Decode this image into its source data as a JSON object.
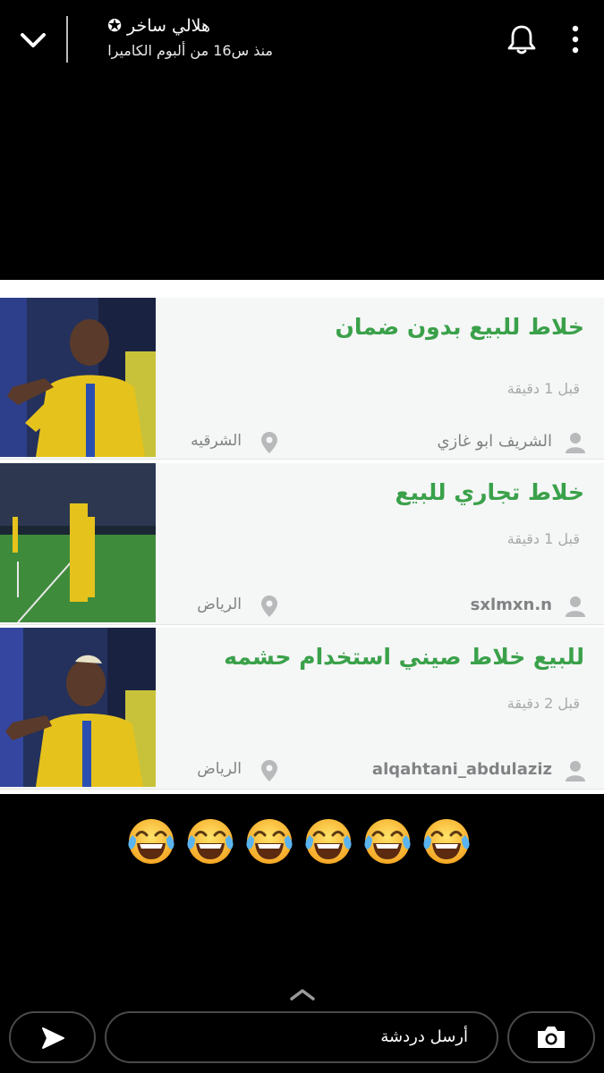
{
  "header": {
    "sender_name": "هلالي ساخر ✪",
    "subtitle": "منذ س16 من ألبوم الكاميرا",
    "back_icon": "chevron-down-icon",
    "notify_icon": "bell-icon",
    "more_icon": "more-vertical-icon"
  },
  "listings": [
    {
      "title": "خلاط للبيع بدون ضمان",
      "time": "قبل 1 دقيقة",
      "user": "الشريف ابو غازي",
      "city": "الشرقيه",
      "image": "player-photo"
    },
    {
      "title": "خلاط تجاري للبيع",
      "time": "قبل 1 دقيقة",
      "user": "sxlmxn.n",
      "city": "الرياض",
      "image": "stadium-photo"
    },
    {
      "title": "للبيع خلاط صيني استخدام حشمه",
      "time": "قبل 2 دقيقة",
      "user": "alqahtani_abdulaziz",
      "city": "الرياض",
      "image": "player-photo"
    }
  ],
  "caption": {
    "emoji": "face-with-tears-of-joy",
    "count": 6
  },
  "chat_bar": {
    "placeholder": "أرسل دردشة",
    "send_icon": "send-arrow-icon",
    "camera_icon": "camera-icon",
    "swipe_icon": "chevron-up-icon"
  },
  "colors": {
    "background": "#000000",
    "title_green": "#3aa14a",
    "meta_gray": "#808384",
    "row_bg": "#f5f6f6"
  }
}
